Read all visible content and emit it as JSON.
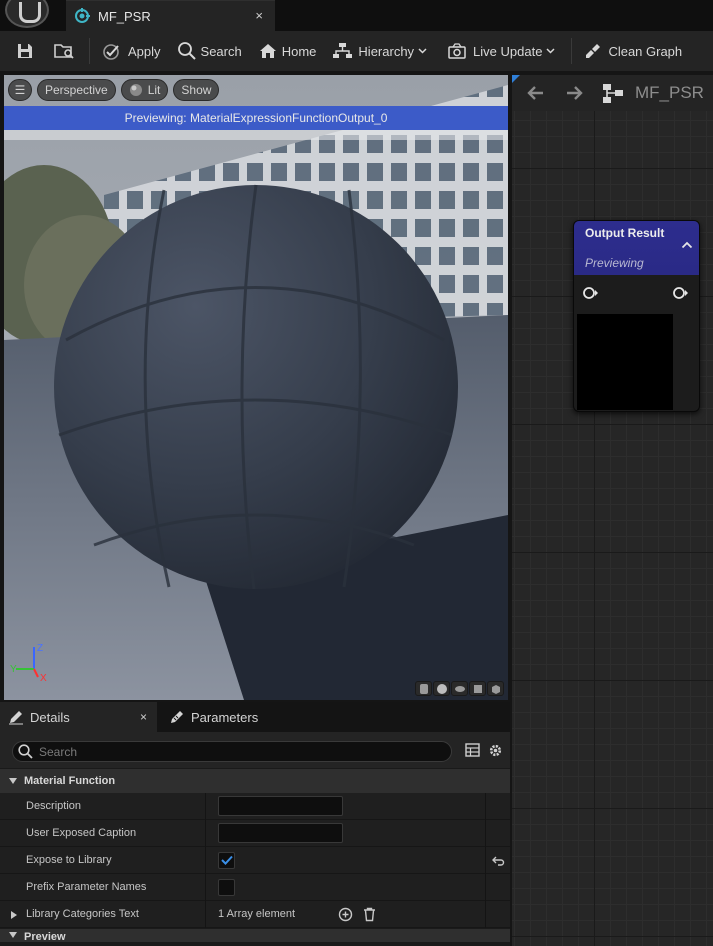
{
  "window": {
    "tab_title": "MF_PSR",
    "close_glyph": "×"
  },
  "toolbar": {
    "apply_label": "Apply",
    "search_label": "Search",
    "home_label": "Home",
    "hierarchy_label": "Hierarchy",
    "live_update_label": "Live Update",
    "clean_graph_label": "Clean Graph"
  },
  "viewport": {
    "menu_glyph": "☰",
    "perspective_label": "Perspective",
    "lit_label": "Lit",
    "show_label": "Show",
    "previewing_text": "Previewing: MaterialExpressionFunctionOutput_0",
    "axis_z": "Z",
    "axis_y": "Y",
    "axis_x": "X"
  },
  "graph": {
    "title": "MF_PSR",
    "node": {
      "title": "Output Result",
      "subtitle": "Previewing"
    }
  },
  "details": {
    "tabs": [
      {
        "label": "Details"
      },
      {
        "label": "Parameters"
      }
    ],
    "close_glyph": "×",
    "search_placeholder": "Search",
    "categories": {
      "material_function": "Material Function",
      "preview": "Preview"
    },
    "properties": {
      "description": {
        "label": "Description",
        "value": ""
      },
      "user_exposed_caption": {
        "label": "User Exposed Caption",
        "value": ""
      },
      "expose_to_library": {
        "label": "Expose to Library",
        "checked": true
      },
      "prefix_parameter_names": {
        "label": "Prefix Parameter Names",
        "checked": false
      },
      "library_categories_text": {
        "label": "Library Categories Text",
        "value": "1 Array element"
      }
    }
  },
  "colors": {
    "previewing_bar": "#3c5bc8",
    "node_header": "#2d2d8e",
    "checkbox_check": "#3a8fe8"
  }
}
